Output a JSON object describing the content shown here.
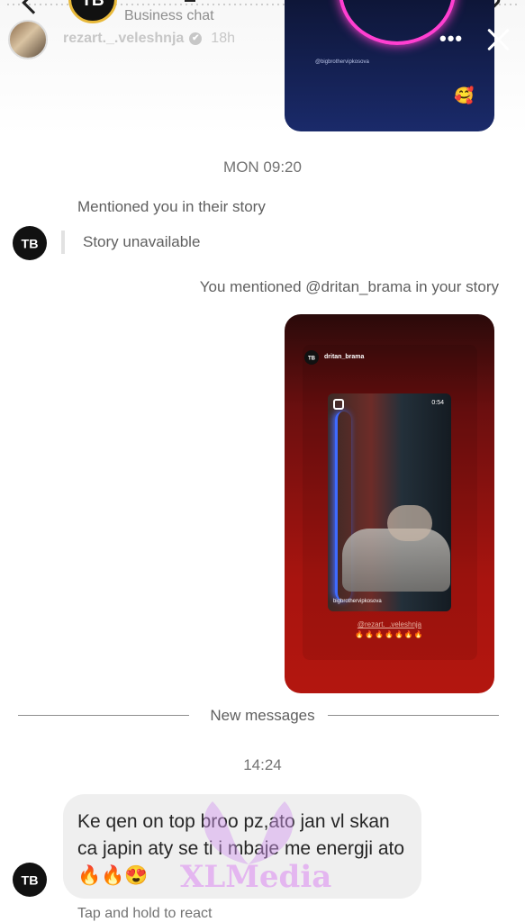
{
  "story_header": {
    "business_chat_label": "Business chat",
    "username": "rezart._.veleshnja",
    "verified_mark": "✔",
    "time_ago": "18h",
    "more_label": "•••",
    "logo_text": "TB"
  },
  "top_card": {
    "handle": "@bigbrothervipkosova",
    "emoji": "🥰"
  },
  "thread": {
    "timestamp_1": "MON 09:20",
    "mention_label": "Mentioned you in their story",
    "story_unavailable": "Story unavailable",
    "you_mentioned": "You mentioned @dritan_brama in your story",
    "avatar_text": "TB"
  },
  "story_card": {
    "account_name": "dritan_brama",
    "video_time": "0:54",
    "video_handle": "bigbrothervipkosova",
    "mention": "@rezart._.veleshnja",
    "fires": "🔥🔥🔥🔥🔥🔥🔥"
  },
  "divider": {
    "label": "New messages"
  },
  "message": {
    "timestamp_2": "14:24",
    "text": "Ke qen on top broo pz,ato jan vl skan ca japin aty se ti i mbaje me energji ato🔥🔥😍",
    "hint": "Tap and hold to react"
  },
  "watermark": {
    "text": "XLMedia"
  },
  "colors": {
    "story_red": "#a8140f",
    "bubble_gray": "#efefef",
    "neon_pink": "#ff3fd1"
  }
}
